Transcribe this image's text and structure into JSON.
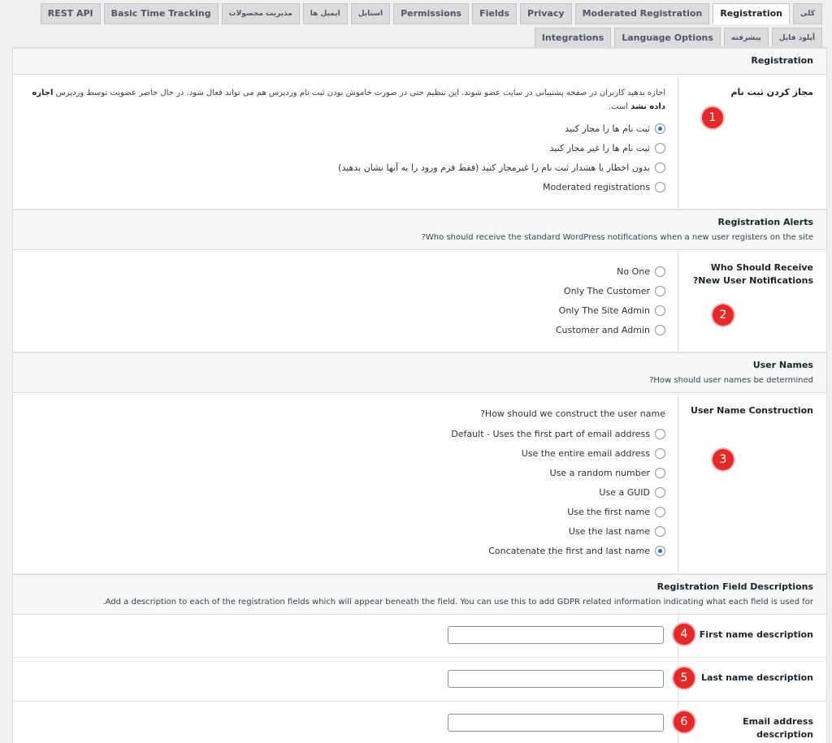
{
  "tabs": [
    {
      "label": "کلی",
      "active": false,
      "small": true
    },
    {
      "label": "Registration",
      "active": true,
      "small": false
    },
    {
      "label": "Moderated Registration",
      "active": false,
      "small": false
    },
    {
      "label": "Privacy",
      "active": false,
      "small": false
    },
    {
      "label": "Fields",
      "active": false,
      "small": false
    },
    {
      "label": "Permissions",
      "active": false,
      "small": false
    },
    {
      "label": "استایل",
      "active": false,
      "small": true
    },
    {
      "label": "ایمیل ها",
      "active": false,
      "small": true
    },
    {
      "label": "مدیریت محصولات",
      "active": false,
      "small": true
    },
    {
      "label": "Basic Time Tracking",
      "active": false,
      "small": false
    },
    {
      "label": "REST API",
      "active": false,
      "small": false
    },
    {
      "label": "آپلود فایل",
      "active": false,
      "small": true
    },
    {
      "label": "پیشرفته",
      "active": false,
      "small": true
    },
    {
      "label": "Language Options",
      "active": false,
      "small": false
    },
    {
      "label": "Integrations",
      "active": false,
      "small": false
    }
  ],
  "sections": {
    "registration": {
      "title": "Registration"
    },
    "alerts": {
      "title": "Registration Alerts",
      "desc": "Who should receive the standard WordPress notifications when a new user registers on the site?"
    },
    "usernames": {
      "title": "User Names",
      "desc": "How should user names be determined?"
    },
    "field_desc": {
      "title": "Registration Field Descriptions",
      "desc": "Add a description to each of the registration fields which will appear beneath the field. You can use this to add GDPR related information indicating what each field is used for."
    }
  },
  "allow_registration": {
    "label": "مجاز کردن ثبت نام",
    "desc_line1": "اجازه بدهید کاربران در صفحه پشتیبانی در سایت عضو شوند. این تنظیم حتی در صورت خاموش بودن ثبت نام وردپرس هم می تواند فعال شود. در حال حاضر عضویت توسط وردپرس",
    "desc_bold": "اجازه داده نشد",
    "desc_tail": "است.",
    "options": [
      {
        "label": "ثبت نام ها را مجاز کنید",
        "checked": true
      },
      {
        "label": "ثبت نام ها را غیر مجاز کنید",
        "checked": false
      },
      {
        "label": "بدون اخطار یا هشدار ثبت نام را غیرمجاز کنید (فقط فرم ورود را به آنها نشان بدهید)",
        "checked": false
      },
      {
        "label": "Moderated registrations",
        "checked": false
      }
    ]
  },
  "notifications": {
    "label": "Who Should Receive New User Notifications?",
    "options": [
      {
        "label": "No One",
        "checked": false
      },
      {
        "label": "Only The Customer",
        "checked": false
      },
      {
        "label": "Only The Site Admin",
        "checked": false
      },
      {
        "label": "Customer and Admin",
        "checked": false
      }
    ]
  },
  "username_construction": {
    "label": "User Name Construction",
    "question": "How should we construct the user name?",
    "options": [
      {
        "label": "Default - Uses the first part of email address",
        "checked": false
      },
      {
        "label": "Use the entire email address",
        "checked": false
      },
      {
        "label": "Use a random number",
        "checked": false
      },
      {
        "label": "Use a GUID",
        "checked": false
      },
      {
        "label": "Use the first name",
        "checked": false
      },
      {
        "label": "Use the last name",
        "checked": false
      },
      {
        "label": "Concatenate the first and last name",
        "checked": true
      }
    ]
  },
  "field_descriptions": {
    "first_name": {
      "label": "First name description",
      "value": ""
    },
    "last_name": {
      "label": "Last name description",
      "value": ""
    },
    "email": {
      "label": "Email address description",
      "value": ""
    }
  },
  "badges": [
    "1",
    "2",
    "3",
    "4",
    "5",
    "6"
  ],
  "colors": {
    "badge": "#e22a2a",
    "radio_checked": "#2271b1",
    "tab_bg": "#dcdcde"
  }
}
